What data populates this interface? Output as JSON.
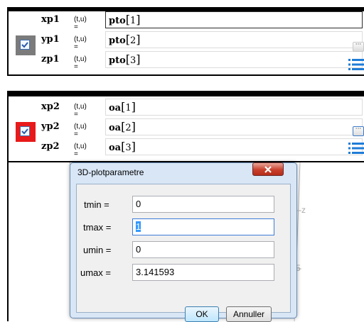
{
  "panel1": {
    "rows": [
      {
        "name": "xp1",
        "params": "(t,u) =",
        "func": "pto",
        "arg": "1"
      },
      {
        "name": "yp1",
        "params": "(t,u) =",
        "func": "pto",
        "arg": "2"
      },
      {
        "name": "zp1",
        "params": "(t,u) =",
        "func": "pto",
        "arg": "3"
      }
    ],
    "checkbox_bg": "#7b7b7b"
  },
  "panel2": {
    "rows": [
      {
        "name": "xp2",
        "params": "(t,u) =",
        "func": "oa",
        "arg": "1"
      },
      {
        "name": "yp2",
        "params": "(t,u) =",
        "func": "oa",
        "arg": "2"
      },
      {
        "name": "zp2",
        "params": "(t,u) =",
        "func": "oa",
        "arg": "3"
      }
    ],
    "checkbox_bg": "#e8191a"
  },
  "bracket_open": "[",
  "bracket_close": "]",
  "background": {
    "axis_label": "z",
    "tick_5": "5"
  },
  "dialog": {
    "title": "3D-plotparametre",
    "fields": [
      {
        "label": "tmin =",
        "value": "0"
      },
      {
        "label": "tmax =",
        "value": "1"
      },
      {
        "label": "umin =",
        "value": "0"
      },
      {
        "label": "umax =",
        "value": "3.141593"
      }
    ],
    "ok_label": "OK",
    "cancel_label": "Annuller"
  }
}
